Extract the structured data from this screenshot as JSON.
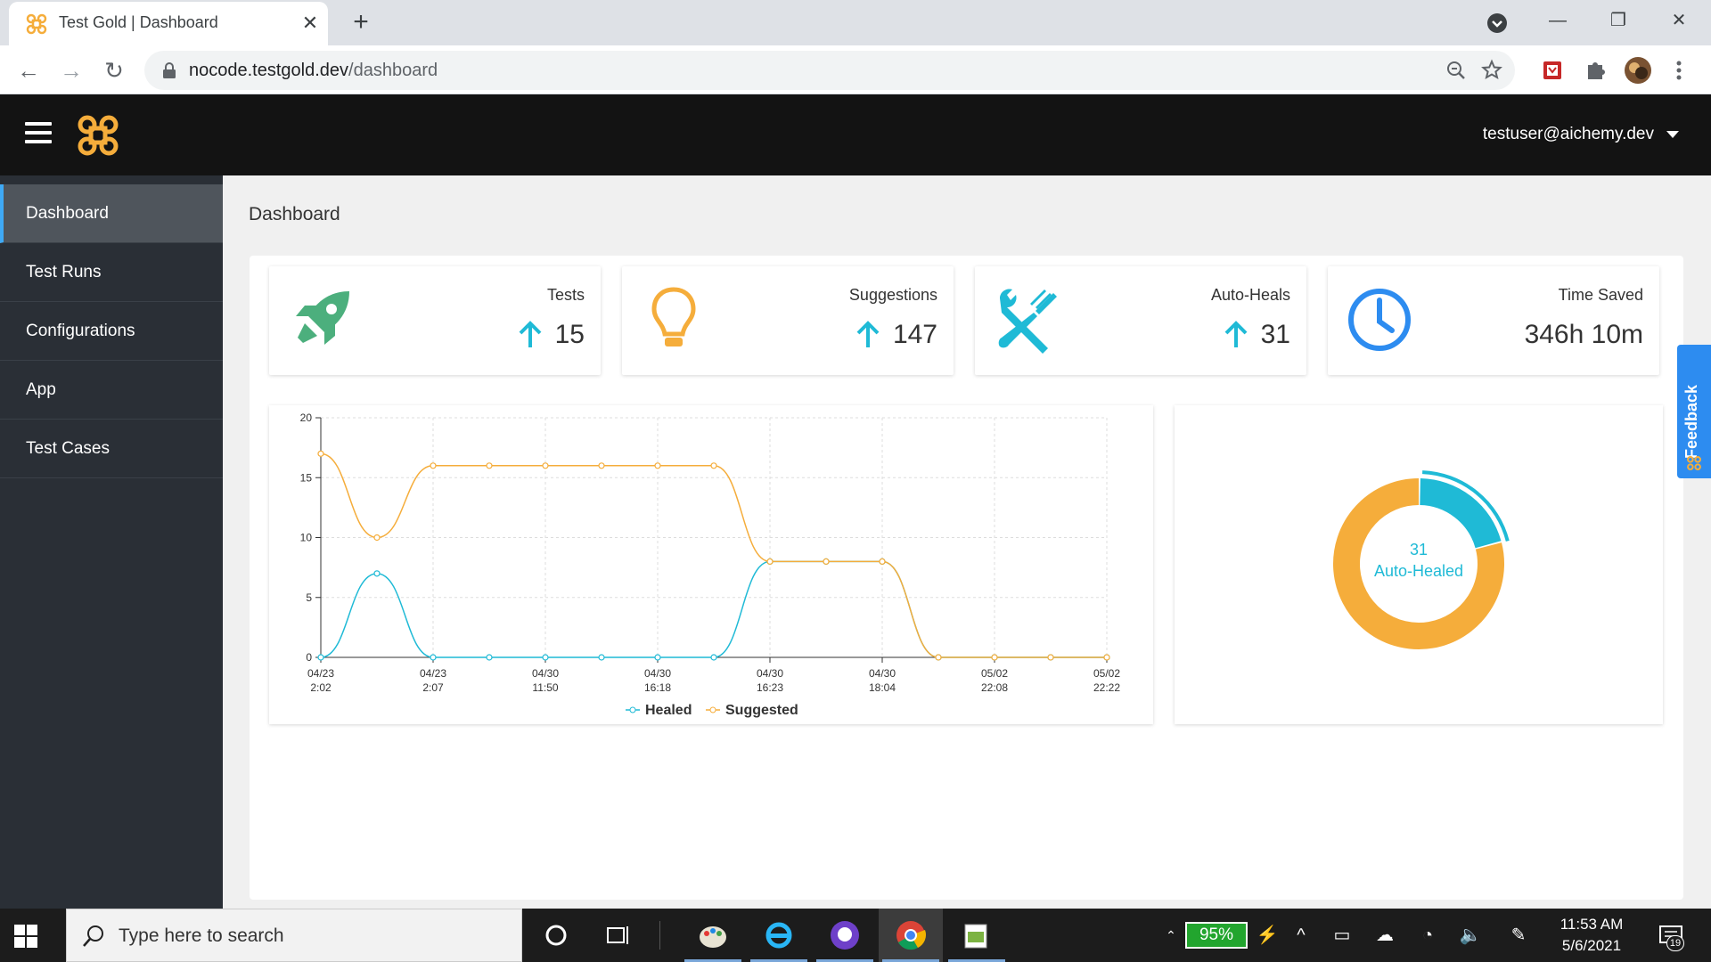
{
  "browser": {
    "tab_title": "Test Gold | Dashboard",
    "tab_close": "✕",
    "new_tab": "+",
    "url_host": "nocode.testgold.dev",
    "url_path": "/dashboard",
    "window_min": "—",
    "window_restore": "❐",
    "window_close": "✕",
    "back": "←",
    "forward": "→",
    "reload": "↻"
  },
  "header": {
    "user_email": "testuser@aichemy.dev"
  },
  "sidebar": {
    "items": [
      {
        "label": "Dashboard"
      },
      {
        "label": "Test Runs"
      },
      {
        "label": "Configurations"
      },
      {
        "label": "App"
      },
      {
        "label": "Test Cases"
      }
    ]
  },
  "page": {
    "title": "Dashboard"
  },
  "stats": [
    {
      "label": "Tests",
      "value": "15",
      "icon": "rocket-icon"
    },
    {
      "label": "Suggestions",
      "value": "147",
      "icon": "lightbulb-icon"
    },
    {
      "label": "Auto-Heals",
      "value": "31",
      "icon": "tools-icon"
    },
    {
      "label": "Time Saved",
      "value": "346h 10m",
      "icon": "clock-icon"
    }
  ],
  "colors": {
    "healed": "#1fbad6",
    "suggested": "#f5ad3b",
    "rocket": "#4caf7d",
    "accent": "#2d8cf0"
  },
  "chart_data": {
    "type": "line",
    "x": [
      "04/23 2:02",
      "",
      "04/23 2:07",
      "",
      "04/30 11:50",
      "",
      "04/30 16:18",
      "",
      "04/30 16:23",
      "",
      "04/30 18:04",
      "",
      "05/02 22:08",
      "",
      "05/02 22:22"
    ],
    "tick_labels": [
      {
        "line1": "04/23",
        "line2": "2:02"
      },
      {
        "line1": "04/23",
        "line2": "2:07"
      },
      {
        "line1": "04/30",
        "line2": "11:50"
      },
      {
        "line1": "04/30",
        "line2": "16:18"
      },
      {
        "line1": "04/30",
        "line2": "16:23"
      },
      {
        "line1": "04/30",
        "line2": "18:04"
      },
      {
        "line1": "05/02",
        "line2": "22:08"
      },
      {
        "line1": "05/02",
        "line2": "22:22"
      }
    ],
    "series": [
      {
        "name": "Healed",
        "values": [
          0,
          7,
          0,
          0,
          0,
          0,
          0,
          0,
          8,
          8,
          8,
          0,
          0,
          0,
          0
        ]
      },
      {
        "name": "Suggested",
        "values": [
          17,
          10,
          16,
          16,
          16,
          16,
          16,
          16,
          8,
          8,
          8,
          0,
          0,
          0,
          0
        ]
      }
    ],
    "ylim": [
      0,
      20
    ],
    "yticks": [
      "0",
      "5",
      "10",
      "15",
      "20"
    ],
    "grid": true,
    "legend": "bottom"
  },
  "donut": {
    "value": "31",
    "label": "Auto-Healed",
    "healed_fraction": 0.21
  },
  "feedback": {
    "label": "Feedback"
  },
  "taskbar": {
    "search_placeholder": "Type here to search",
    "battery": "95%",
    "time": "11:53 AM",
    "date": "5/6/2021",
    "notification_count": "19"
  }
}
